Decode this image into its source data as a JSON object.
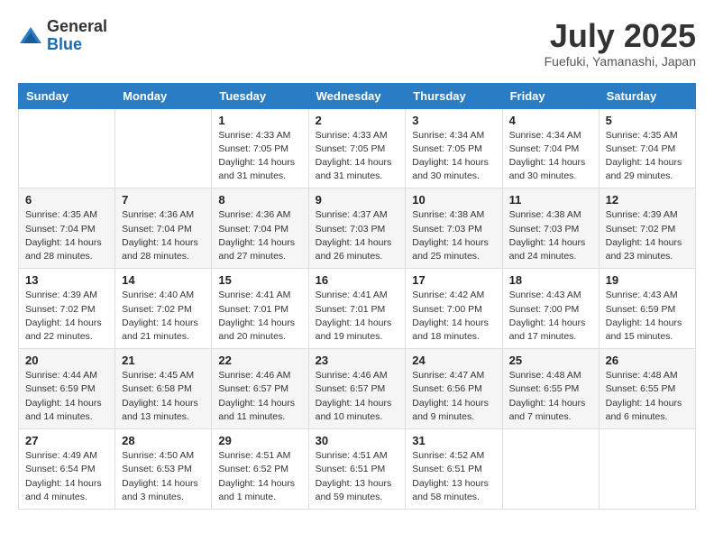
{
  "logo": {
    "general": "General",
    "blue": "Blue"
  },
  "title": "July 2025",
  "location": "Fuefuki, Yamanashi, Japan",
  "days_of_week": [
    "Sunday",
    "Monday",
    "Tuesday",
    "Wednesday",
    "Thursday",
    "Friday",
    "Saturday"
  ],
  "weeks": [
    [
      {
        "day": "",
        "sunrise": "",
        "sunset": "",
        "daylight": ""
      },
      {
        "day": "",
        "sunrise": "",
        "sunset": "",
        "daylight": ""
      },
      {
        "day": "1",
        "sunrise": "Sunrise: 4:33 AM",
        "sunset": "Sunset: 7:05 PM",
        "daylight": "Daylight: 14 hours and 31 minutes."
      },
      {
        "day": "2",
        "sunrise": "Sunrise: 4:33 AM",
        "sunset": "Sunset: 7:05 PM",
        "daylight": "Daylight: 14 hours and 31 minutes."
      },
      {
        "day": "3",
        "sunrise": "Sunrise: 4:34 AM",
        "sunset": "Sunset: 7:05 PM",
        "daylight": "Daylight: 14 hours and 30 minutes."
      },
      {
        "day": "4",
        "sunrise": "Sunrise: 4:34 AM",
        "sunset": "Sunset: 7:04 PM",
        "daylight": "Daylight: 14 hours and 30 minutes."
      },
      {
        "day": "5",
        "sunrise": "Sunrise: 4:35 AM",
        "sunset": "Sunset: 7:04 PM",
        "daylight": "Daylight: 14 hours and 29 minutes."
      }
    ],
    [
      {
        "day": "6",
        "sunrise": "Sunrise: 4:35 AM",
        "sunset": "Sunset: 7:04 PM",
        "daylight": "Daylight: 14 hours and 28 minutes."
      },
      {
        "day": "7",
        "sunrise": "Sunrise: 4:36 AM",
        "sunset": "Sunset: 7:04 PM",
        "daylight": "Daylight: 14 hours and 28 minutes."
      },
      {
        "day": "8",
        "sunrise": "Sunrise: 4:36 AM",
        "sunset": "Sunset: 7:04 PM",
        "daylight": "Daylight: 14 hours and 27 minutes."
      },
      {
        "day": "9",
        "sunrise": "Sunrise: 4:37 AM",
        "sunset": "Sunset: 7:03 PM",
        "daylight": "Daylight: 14 hours and 26 minutes."
      },
      {
        "day": "10",
        "sunrise": "Sunrise: 4:38 AM",
        "sunset": "Sunset: 7:03 PM",
        "daylight": "Daylight: 14 hours and 25 minutes."
      },
      {
        "day": "11",
        "sunrise": "Sunrise: 4:38 AM",
        "sunset": "Sunset: 7:03 PM",
        "daylight": "Daylight: 14 hours and 24 minutes."
      },
      {
        "day": "12",
        "sunrise": "Sunrise: 4:39 AM",
        "sunset": "Sunset: 7:02 PM",
        "daylight": "Daylight: 14 hours and 23 minutes."
      }
    ],
    [
      {
        "day": "13",
        "sunrise": "Sunrise: 4:39 AM",
        "sunset": "Sunset: 7:02 PM",
        "daylight": "Daylight: 14 hours and 22 minutes."
      },
      {
        "day": "14",
        "sunrise": "Sunrise: 4:40 AM",
        "sunset": "Sunset: 7:02 PM",
        "daylight": "Daylight: 14 hours and 21 minutes."
      },
      {
        "day": "15",
        "sunrise": "Sunrise: 4:41 AM",
        "sunset": "Sunset: 7:01 PM",
        "daylight": "Daylight: 14 hours and 20 minutes."
      },
      {
        "day": "16",
        "sunrise": "Sunrise: 4:41 AM",
        "sunset": "Sunset: 7:01 PM",
        "daylight": "Daylight: 14 hours and 19 minutes."
      },
      {
        "day": "17",
        "sunrise": "Sunrise: 4:42 AM",
        "sunset": "Sunset: 7:00 PM",
        "daylight": "Daylight: 14 hours and 18 minutes."
      },
      {
        "day": "18",
        "sunrise": "Sunrise: 4:43 AM",
        "sunset": "Sunset: 7:00 PM",
        "daylight": "Daylight: 14 hours and 17 minutes."
      },
      {
        "day": "19",
        "sunrise": "Sunrise: 4:43 AM",
        "sunset": "Sunset: 6:59 PM",
        "daylight": "Daylight: 14 hours and 15 minutes."
      }
    ],
    [
      {
        "day": "20",
        "sunrise": "Sunrise: 4:44 AM",
        "sunset": "Sunset: 6:59 PM",
        "daylight": "Daylight: 14 hours and 14 minutes."
      },
      {
        "day": "21",
        "sunrise": "Sunrise: 4:45 AM",
        "sunset": "Sunset: 6:58 PM",
        "daylight": "Daylight: 14 hours and 13 minutes."
      },
      {
        "day": "22",
        "sunrise": "Sunrise: 4:46 AM",
        "sunset": "Sunset: 6:57 PM",
        "daylight": "Daylight: 14 hours and 11 minutes."
      },
      {
        "day": "23",
        "sunrise": "Sunrise: 4:46 AM",
        "sunset": "Sunset: 6:57 PM",
        "daylight": "Daylight: 14 hours and 10 minutes."
      },
      {
        "day": "24",
        "sunrise": "Sunrise: 4:47 AM",
        "sunset": "Sunset: 6:56 PM",
        "daylight": "Daylight: 14 hours and 9 minutes."
      },
      {
        "day": "25",
        "sunrise": "Sunrise: 4:48 AM",
        "sunset": "Sunset: 6:55 PM",
        "daylight": "Daylight: 14 hours and 7 minutes."
      },
      {
        "day": "26",
        "sunrise": "Sunrise: 4:48 AM",
        "sunset": "Sunset: 6:55 PM",
        "daylight": "Daylight: 14 hours and 6 minutes."
      }
    ],
    [
      {
        "day": "27",
        "sunrise": "Sunrise: 4:49 AM",
        "sunset": "Sunset: 6:54 PM",
        "daylight": "Daylight: 14 hours and 4 minutes."
      },
      {
        "day": "28",
        "sunrise": "Sunrise: 4:50 AM",
        "sunset": "Sunset: 6:53 PM",
        "daylight": "Daylight: 14 hours and 3 minutes."
      },
      {
        "day": "29",
        "sunrise": "Sunrise: 4:51 AM",
        "sunset": "Sunset: 6:52 PM",
        "daylight": "Daylight: 14 hours and 1 minute."
      },
      {
        "day": "30",
        "sunrise": "Sunrise: 4:51 AM",
        "sunset": "Sunset: 6:51 PM",
        "daylight": "Daylight: 13 hours and 59 minutes."
      },
      {
        "day": "31",
        "sunrise": "Sunrise: 4:52 AM",
        "sunset": "Sunset: 6:51 PM",
        "daylight": "Daylight: 13 hours and 58 minutes."
      },
      {
        "day": "",
        "sunrise": "",
        "sunset": "",
        "daylight": ""
      },
      {
        "day": "",
        "sunrise": "",
        "sunset": "",
        "daylight": ""
      }
    ]
  ]
}
